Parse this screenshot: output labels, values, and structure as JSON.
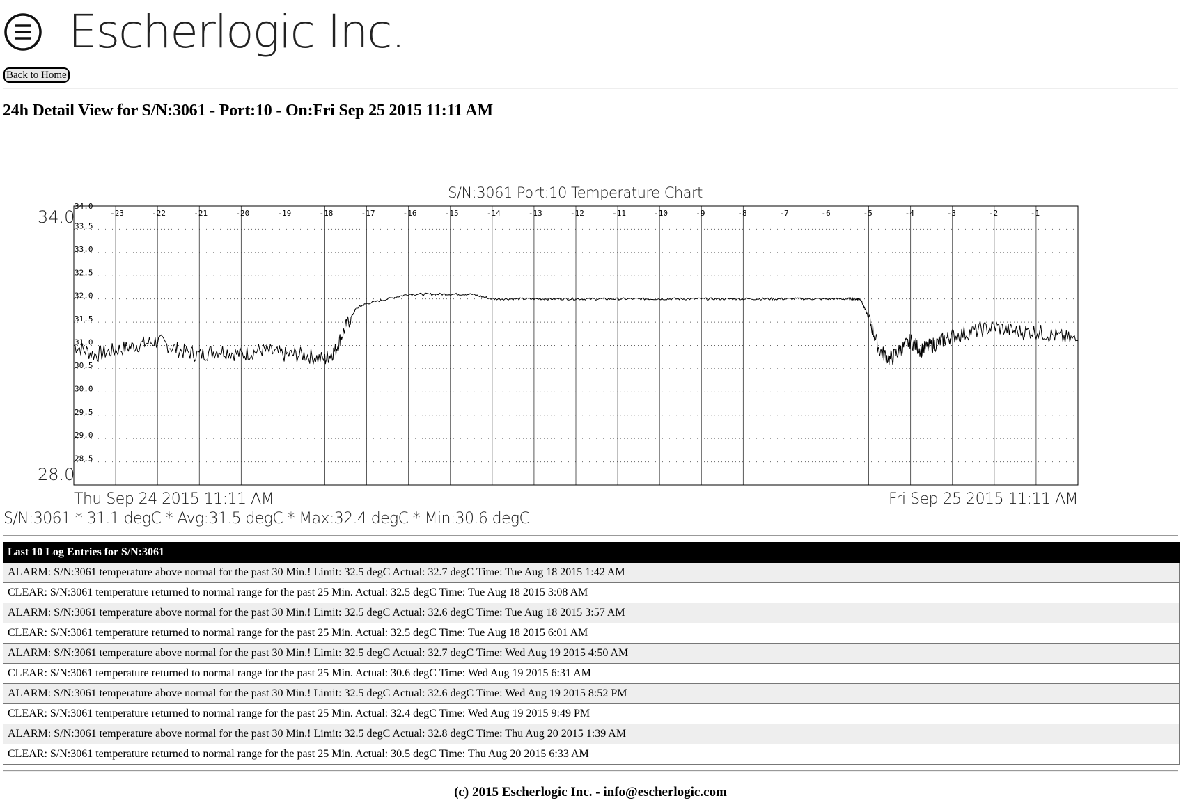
{
  "header": {
    "company_name": "Escherlogic Inc.",
    "logo_icon": "hamburger-circle-icon"
  },
  "nav": {
    "back_home_label": "Back to Home"
  },
  "page": {
    "title": "24h Detail View for S/N:3061 - Port:10 - On:Fri Sep 25 2015 11:11 AM"
  },
  "chart_data": {
    "type": "line",
    "title": "S/N:3061 Port:10 Temperature Chart",
    "ylim": [
      28.0,
      34.0
    ],
    "y_max_label": "34.0",
    "y_min_label": "28.0",
    "y_ticks": [
      "34.0",
      "33.5",
      "33.0",
      "32.5",
      "32.0",
      "31.5",
      "31.0",
      "30.5",
      "30.0",
      "29.5",
      "29.0",
      "28.5"
    ],
    "x_ticks": [
      "-23",
      "-22",
      "-21",
      "-20",
      "-19",
      "-18",
      "-17",
      "-16",
      "-15",
      "-14",
      "-13",
      "-12",
      "-11",
      "-10",
      "-9",
      "-8",
      "-7",
      "-6",
      "-5",
      "-4",
      "-3",
      "-2",
      "-1"
    ],
    "x_start_label": "Thu Sep 24 2015 11:11 AM",
    "x_end_label": "Fri Sep 25 2015 11:11 AM",
    "xlim": [
      -24,
      0
    ],
    "grid": true,
    "series": [
      {
        "x": [
          -24,
          -23.5,
          -23,
          -22.5,
          -22,
          -21.5,
          -21,
          -20.5,
          -20,
          -19.5,
          -19,
          -18.5,
          -18,
          -17.75,
          -17.5,
          -17.25,
          -17,
          -16.5,
          -16,
          -15.5,
          -15,
          -14.5,
          -14,
          -13.5,
          -13,
          -12.5,
          -12,
          -11.5,
          -11,
          -10.5,
          -10,
          -9.5,
          -9,
          -8.5,
          -8,
          -7.5,
          -7,
          -6.5,
          -6,
          -5.5,
          -5.3,
          -5.2,
          -5,
          -4.75,
          -4.5,
          -4.25,
          -4,
          -3.75,
          -3.5,
          -3.25,
          -3,
          -2.5,
          -2,
          -1.5,
          -1,
          -0.5,
          0
        ],
        "values": [
          31.0,
          30.8,
          30.9,
          31.0,
          31.1,
          30.9,
          30.8,
          30.9,
          30.8,
          30.9,
          30.8,
          30.8,
          30.7,
          30.9,
          31.4,
          31.8,
          31.9,
          32.0,
          32.1,
          32.1,
          32.1,
          32.1,
          32.0,
          32.0,
          32.0,
          32.0,
          32.0,
          32.0,
          32.0,
          32.0,
          32.0,
          32.0,
          32.0,
          32.0,
          32.0,
          32.0,
          32.0,
          32.0,
          32.0,
          32.0,
          32.0,
          32.0,
          31.6,
          30.9,
          30.7,
          30.9,
          31.1,
          30.9,
          31.0,
          31.1,
          31.2,
          31.3,
          31.4,
          31.3,
          31.3,
          31.2,
          31.1
        ]
      }
    ]
  },
  "summary": {
    "text": "S/N:3061 * 31.1 degC * Avg:31.5 degC * Max:32.4 degC * Min:30.6 degC"
  },
  "log": {
    "header": "Last 10 Log Entries for S/N:3061",
    "entries": [
      "ALARM: S/N:3061 temperature above normal for the past 30 Min.! Limit: 32.5 degC Actual: 32.7 degC Time: Tue Aug 18 2015 1:42 AM",
      "CLEAR: S/N:3061 temperature returned to normal range for the past 25 Min. Actual: 32.5 degC Time: Tue Aug 18 2015 3:08 AM",
      "ALARM: S/N:3061 temperature above normal for the past 30 Min.! Limit: 32.5 degC Actual: 32.6 degC Time: Tue Aug 18 2015 3:57 AM",
      "CLEAR: S/N:3061 temperature returned to normal range for the past 25 Min. Actual: 32.5 degC Time: Tue Aug 18 2015 6:01 AM",
      "ALARM: S/N:3061 temperature above normal for the past 30 Min.! Limit: 32.5 degC Actual: 32.7 degC Time: Wed Aug 19 2015 4:50 AM",
      "CLEAR: S/N:3061 temperature returned to normal range for the past 25 Min. Actual: 30.6 degC Time: Wed Aug 19 2015 6:31 AM",
      "ALARM: S/N:3061 temperature above normal for the past 30 Min.! Limit: 32.5 degC Actual: 32.6 degC Time: Wed Aug 19 2015 8:52 PM",
      "CLEAR: S/N:3061 temperature returned to normal range for the past 25 Min. Actual: 32.4 degC Time: Wed Aug 19 2015 9:49 PM",
      "ALARM: S/N:3061 temperature above normal for the past 30 Min.! Limit: 32.5 degC Actual: 32.8 degC Time: Thu Aug 20 2015 1:39 AM",
      "CLEAR: S/N:3061 temperature returned to normal range for the past 25 Min. Actual: 30.5 degC Time: Thu Aug 20 2015 6:33 AM"
    ]
  },
  "footer": {
    "text": "(c) 2015 Escherlogic Inc. - info@escherlogic.com"
  }
}
